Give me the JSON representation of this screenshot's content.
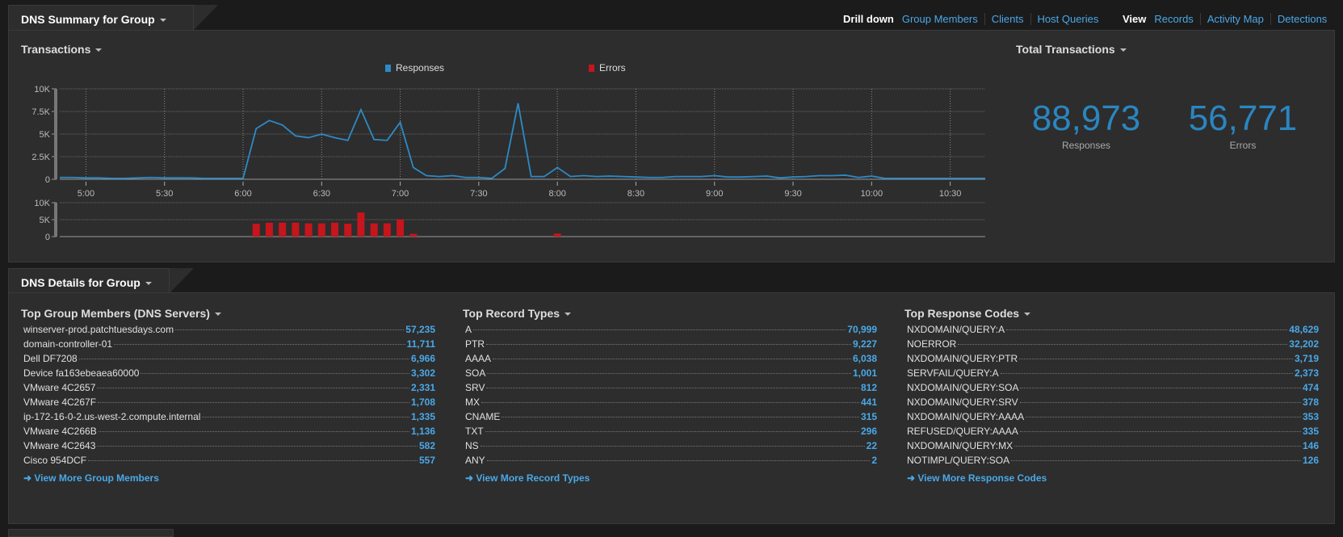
{
  "summary": {
    "tab_title": "DNS Summary for Group",
    "drill_down_label": "Drill down",
    "drill_down_links": [
      "Group Members",
      "Clients",
      "Host Queries"
    ],
    "view_label": "View",
    "view_links": [
      "Records",
      "Activity Map",
      "Detections"
    ],
    "transactions_title": "Transactions",
    "total_title": "Total Transactions",
    "totals": [
      {
        "value": "88,973",
        "label": "Responses"
      },
      {
        "value": "56,771",
        "label": "Errors"
      }
    ]
  },
  "colors": {
    "responses": "#2d8ac6",
    "errors": "#c4161c",
    "link": "#4aa8e8",
    "total": "#2a86c0"
  },
  "chart_data": [
    {
      "type": "line",
      "legend": [
        "Responses",
        "Errors"
      ],
      "legend_placement": "top",
      "ylim": [
        0,
        10000
      ],
      "y_ticks": [
        "0",
        "2.5K",
        "5K",
        "7.5K",
        "10K"
      ],
      "x_ticks": [
        "5:00",
        "5:30",
        "6:00",
        "6:30",
        "7:00",
        "7:30",
        "8:00",
        "8:30",
        "9:00",
        "9:30",
        "10:00",
        "10:30"
      ],
      "grid": true,
      "series": [
        {
          "name": "Responses",
          "x": [
            "4:50",
            "4:55",
            "5:00",
            "5:05",
            "5:10",
            "5:15",
            "5:20",
            "5:25",
            "5:30",
            "5:35",
            "5:40",
            "5:45",
            "5:50",
            "5:55",
            "6:00",
            "6:05",
            "6:10",
            "6:15",
            "6:20",
            "6:25",
            "6:30",
            "6:35",
            "6:40",
            "6:45",
            "6:50",
            "6:55",
            "7:00",
            "7:05",
            "7:10",
            "7:15",
            "7:20",
            "7:25",
            "7:30",
            "7:35",
            "7:40",
            "7:45",
            "7:50",
            "7:55",
            "8:00",
            "8:05",
            "8:10",
            "8:15",
            "8:20",
            "8:25",
            "8:30",
            "8:35",
            "8:40",
            "8:45",
            "8:50",
            "8:55",
            "9:00",
            "9:05",
            "9:10",
            "9:15",
            "9:20",
            "9:25",
            "9:30",
            "9:35",
            "9:40",
            "9:45",
            "9:50",
            "9:55",
            "10:00",
            "10:05",
            "10:10",
            "10:15",
            "10:20",
            "10:25",
            "10:30",
            "10:35",
            "10:40",
            "10:45"
          ],
          "values": [
            200,
            200,
            150,
            150,
            100,
            100,
            150,
            200,
            150,
            150,
            150,
            100,
            100,
            100,
            100,
            5600,
            6500,
            6000,
            4800,
            4600,
            5000,
            4600,
            4300,
            7700,
            4400,
            4300,
            6300,
            1300,
            400,
            300,
            400,
            200,
            200,
            100,
            1200,
            8400,
            300,
            300,
            1300,
            300,
            400,
            300,
            350,
            300,
            250,
            200,
            200,
            300,
            300,
            300,
            400,
            250,
            250,
            300,
            350,
            150,
            250,
            300,
            400,
            400,
            450,
            200,
            350,
            100,
            100,
            100,
            100,
            100,
            100,
            100,
            100,
            100
          ]
        }
      ]
    },
    {
      "type": "bar",
      "ylim": [
        0,
        10000
      ],
      "y_ticks": [
        "0",
        "5K",
        "10K"
      ],
      "grid": true,
      "series": [
        {
          "name": "Errors",
          "x": [
            "6:05",
            "6:10",
            "6:15",
            "6:20",
            "6:25",
            "6:30",
            "6:35",
            "6:40",
            "6:45",
            "6:50",
            "6:55",
            "7:00",
            "7:05",
            "8:00"
          ],
          "values": [
            3800,
            4100,
            4100,
            4100,
            3900,
            3900,
            4100,
            3800,
            7100,
            3900,
            3900,
            5100,
            800,
            900
          ]
        }
      ]
    }
  ],
  "details": {
    "tab_title": "DNS Details for Group",
    "columns": [
      {
        "title": "Top Group Members (DNS Servers)",
        "rows": [
          {
            "name": "winserver-prod.patchtuesdays.com",
            "value": "57,235"
          },
          {
            "name": "domain-controller-01",
            "value": "11,711"
          },
          {
            "name": "Dell DF7208",
            "value": "6,966"
          },
          {
            "name": "Device fa163ebeaea60000",
            "value": "3,302"
          },
          {
            "name": "VMware 4C2657",
            "value": "2,331"
          },
          {
            "name": "VMware 4C267F",
            "value": "1,708"
          },
          {
            "name": "ip-172-16-0-2.us-west-2.compute.internal",
            "value": "1,335"
          },
          {
            "name": "VMware 4C266B",
            "value": "1,136"
          },
          {
            "name": "VMware 4C2643",
            "value": "582"
          },
          {
            "name": "Cisco 954DCF",
            "value": "557"
          }
        ],
        "more": "View More Group Members"
      },
      {
        "title": "Top Record Types",
        "rows": [
          {
            "name": "A",
            "value": "70,999"
          },
          {
            "name": "PTR",
            "value": "9,227"
          },
          {
            "name": "AAAA",
            "value": "6,038"
          },
          {
            "name": "SOA",
            "value": "1,001"
          },
          {
            "name": "SRV",
            "value": "812"
          },
          {
            "name": "MX",
            "value": "441"
          },
          {
            "name": "CNAME",
            "value": "315"
          },
          {
            "name": "TXT",
            "value": "296"
          },
          {
            "name": "NS",
            "value": "22"
          },
          {
            "name": "ANY",
            "value": "2"
          }
        ],
        "more": "View More Record Types"
      },
      {
        "title": "Top Response Codes",
        "rows": [
          {
            "name": "NXDOMAIN/QUERY:A",
            "value": "48,629"
          },
          {
            "name": "NOERROR",
            "value": "32,202"
          },
          {
            "name": "NXDOMAIN/QUERY:PTR",
            "value": "3,719"
          },
          {
            "name": "SERVFAIL/QUERY:A",
            "value": "2,373"
          },
          {
            "name": "NXDOMAIN/QUERY:SOA",
            "value": "474"
          },
          {
            "name": "NXDOMAIN/QUERY:SRV",
            "value": "378"
          },
          {
            "name": "NXDOMAIN/QUERY:AAAA",
            "value": "353"
          },
          {
            "name": "REFUSED/QUERY:AAAA",
            "value": "335"
          },
          {
            "name": "NXDOMAIN/QUERY:MX",
            "value": "146"
          },
          {
            "name": "NOTIMPL/QUERY:SOA",
            "value": "126"
          }
        ],
        "more": "View More Response Codes"
      }
    ]
  }
}
